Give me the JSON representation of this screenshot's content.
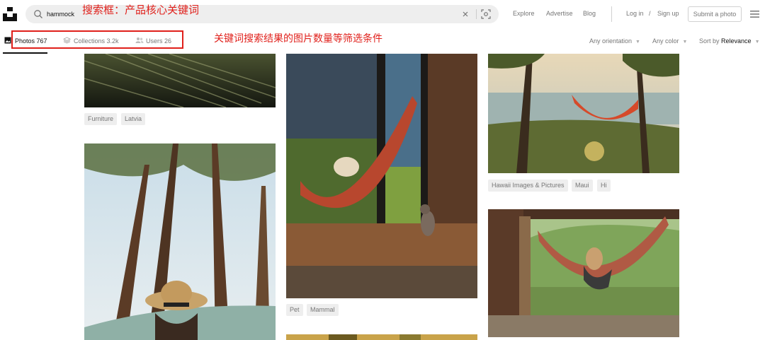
{
  "header": {
    "search_value": "hammock",
    "annotation": "搜索框：产品核心关键词",
    "nav": {
      "explore": "Explore",
      "advertise": "Advertise",
      "blog": "Blog",
      "login": "Log in",
      "slash": "/",
      "signup": "Sign up"
    },
    "submit_label": "Submit a photo"
  },
  "tabs": {
    "photos": "Photos 767",
    "collections": "Collections 3.2k",
    "users": "Users 26",
    "annotation": "关键词搜索结果的图片数量等筛选条件"
  },
  "filters": {
    "orientation": "Any orientation",
    "color": "Any color",
    "sort_prefix": "Sort by",
    "sort_value": "Relevance"
  },
  "columns": {
    "col1": {
      "tags1": [
        "Furniture",
        "Latvia"
      ]
    },
    "col2": {
      "tags1": [
        "Pet",
        "Mammal"
      ]
    },
    "col3": {
      "tags1": [
        "Hawaii Images & Pictures",
        "Maui",
        "Hi"
      ]
    }
  },
  "colors": {
    "accent_red": "#e0201b",
    "tag_bg": "#eeeeee",
    "text_gray": "#767676"
  }
}
